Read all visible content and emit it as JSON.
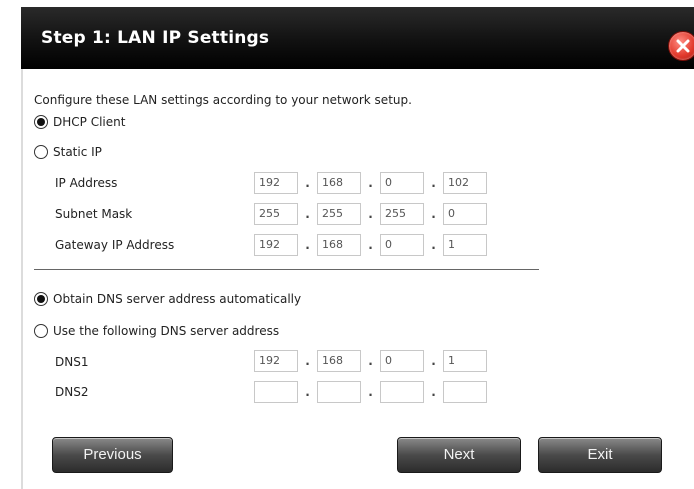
{
  "dialog": {
    "title": "Step 1: LAN IP Settings",
    "intro": "Configure these LAN settings according to your network setup."
  },
  "ip_mode": {
    "dhcp_label": "DHCP Client",
    "static_label": "Static IP",
    "selected": "dhcp"
  },
  "network": {
    "ip_label": "IP Address",
    "ip": [
      "192",
      "168",
      "0",
      "102"
    ],
    "subnet_label": "Subnet Mask",
    "subnet": [
      "255",
      "255",
      "255",
      "0"
    ],
    "gateway_label": "Gateway IP Address",
    "gateway": [
      "192",
      "168",
      "0",
      "1"
    ]
  },
  "dns_mode": {
    "auto_label": "Obtain DNS server address automatically",
    "manual_label": "Use the following DNS server address",
    "selected": "auto"
  },
  "dns": {
    "dns1_label": "DNS1",
    "dns1": [
      "192",
      "168",
      "0",
      "1"
    ],
    "dns2_label": "DNS2",
    "dns2": [
      "",
      "",
      "",
      ""
    ]
  },
  "buttons": {
    "previous": "Previous",
    "next": "Next",
    "exit": "Exit"
  },
  "icons": {
    "close": "close-icon",
    "close_color": "#e23b2e"
  }
}
